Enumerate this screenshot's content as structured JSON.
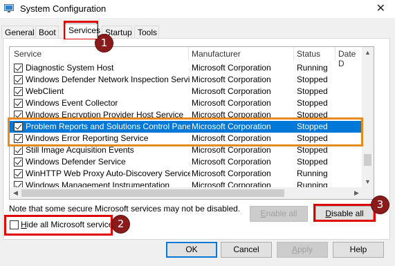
{
  "window": {
    "title": "System Configuration",
    "close_glyph": "✕"
  },
  "tabs": [
    {
      "label": "General",
      "active": false
    },
    {
      "label": "Boot",
      "active": false
    },
    {
      "label": "Services",
      "active": true
    },
    {
      "label": "Startup",
      "active": false
    },
    {
      "label": "Tools",
      "active": false
    }
  ],
  "columns": [
    "Service",
    "Manufacturer",
    "Status",
    "Date D"
  ],
  "services": [
    {
      "name": "Diagnostic System Host",
      "manufacturer": "Microsoft Corporation",
      "status": "Running",
      "checked": true
    },
    {
      "name": "Windows Defender Network Inspection Service",
      "manufacturer": "Microsoft Corporation",
      "status": "Stopped",
      "checked": true
    },
    {
      "name": "WebClient",
      "manufacturer": "Microsoft Corporation",
      "status": "Stopped",
      "checked": true
    },
    {
      "name": "Windows Event Collector",
      "manufacturer": "Microsoft Corporation",
      "status": "Stopped",
      "checked": true
    },
    {
      "name": "Windows Encryption Provider Host Service",
      "manufacturer": "Microsoft Corporation",
      "status": "Stopped",
      "checked": true
    },
    {
      "name": "Problem Reports and Solutions Control Panel ...",
      "manufacturer": "Microsoft Corporation",
      "status": "Stopped",
      "checked": true,
      "selected": true
    },
    {
      "name": "Windows Error Reporting Service",
      "manufacturer": "Microsoft Corporation",
      "status": "Stopped",
      "checked": true
    },
    {
      "name": "Still Image Acquisition Events",
      "manufacturer": "Microsoft Corporation",
      "status": "Stopped",
      "checked": true
    },
    {
      "name": "Windows Defender Service",
      "manufacturer": "Microsoft Corporation",
      "status": "Stopped",
      "checked": true
    },
    {
      "name": "WinHTTP Web Proxy Auto-Discovery Service",
      "manufacturer": "Microsoft Corporation",
      "status": "Running",
      "checked": true
    },
    {
      "name": "Windows Management Instrumentation",
      "manufacturer": "Microsoft Corporation",
      "status": "Running",
      "checked": true
    }
  ],
  "note": "Note that some secure Microsoft services may not be disabled.",
  "buttons": {
    "enable_all": "Enable all",
    "disable_all": "Disable all",
    "ok": "OK",
    "cancel": "Cancel",
    "apply": "Apply",
    "help": "Help"
  },
  "hide_ms": {
    "label": "Hide all Microsoft services",
    "checked": false
  },
  "badges": [
    "1",
    "2",
    "3"
  ],
  "colors": {
    "highlight_red": "#e00000",
    "highlight_orange": "#e48a1f",
    "badge": "#8b1a1a",
    "selection": "#0078d7"
  }
}
